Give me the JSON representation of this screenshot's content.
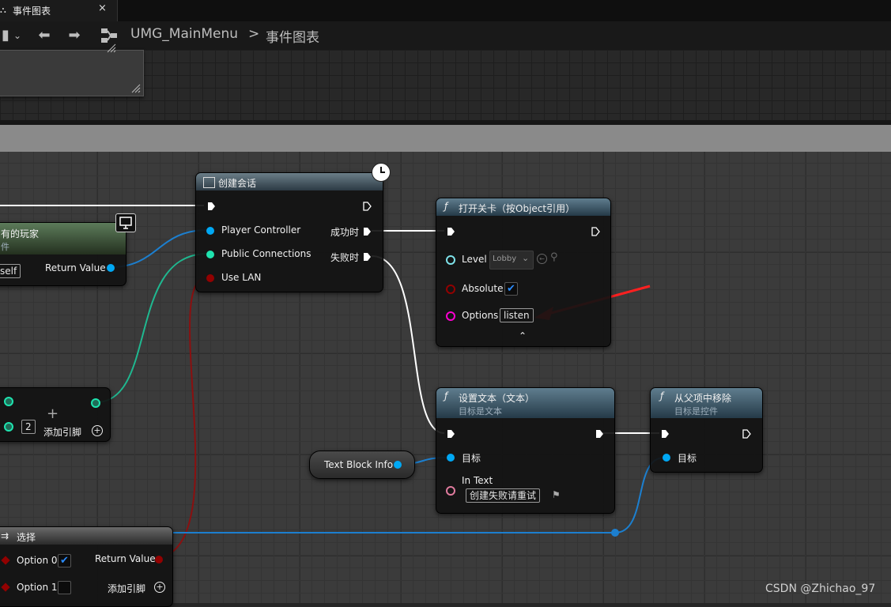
{
  "tab": {
    "title": "事件图表",
    "close": "×"
  },
  "breadcrumb": {
    "root": "UMG_MainMenu",
    "separator": ">",
    "current": "事件图表"
  },
  "nodes": {
    "get_players": {
      "title": "有的玩家",
      "subtitle": "件",
      "self_label": "self",
      "return_value": "Return Value"
    },
    "create_session": {
      "title": "创建会话",
      "pins_in": [
        "Player Controller",
        "Public Connections",
        "Use LAN"
      ],
      "pins_out": [
        "成功时",
        "失败时"
      ]
    },
    "open_level": {
      "title": "打开关卡（按Object引用）",
      "level_label": "Level",
      "level_value": "Lobby",
      "absolute_label": "Absolute",
      "options_label": "Options",
      "options_value": "listen"
    },
    "make_array": {
      "index_value": "2",
      "add_pin": "添加引脚"
    },
    "set_text": {
      "title": "设置文本（文本）",
      "subtitle": "目标是文本",
      "target_label": "目标",
      "in_text_label": "In Text",
      "in_text_value": "创建失败请重试"
    },
    "remove_from_parent": {
      "title": "从父项中移除",
      "subtitle": "目标是控件",
      "target_label": "目标"
    },
    "text_block_info": {
      "label": "Text Block Info"
    },
    "select": {
      "title": "选择",
      "option0": "Option 0",
      "option1": "Option 1",
      "return_value": "Return Value",
      "add_pin": "添加引脚"
    }
  },
  "watermark": "CSDN @Zhichao_97",
  "colors": {
    "exec": "#ffffff",
    "object": "#00a8f4",
    "int": "#1fe3af",
    "bool": "#920101",
    "string": "#fb00d1",
    "text": "#e07b9e",
    "annotation_arrow": "#ff2020"
  }
}
